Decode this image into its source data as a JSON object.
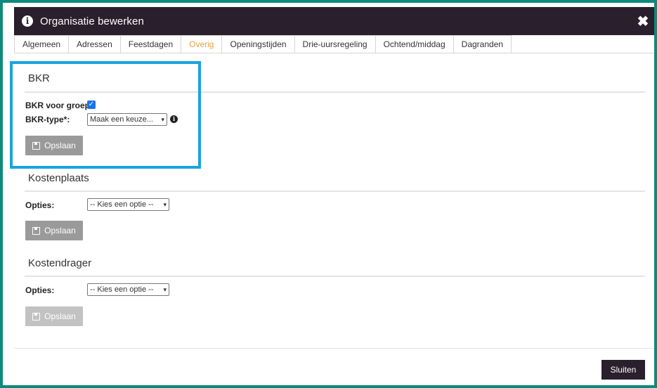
{
  "dialog": {
    "title": "Organisatie bewerken",
    "close_icon": "close-icon",
    "info_icon": "info-icon"
  },
  "tabs": [
    {
      "label": "Algemeen",
      "active": false
    },
    {
      "label": "Adressen",
      "active": false
    },
    {
      "label": "Feestdagen",
      "active": false
    },
    {
      "label": "Overig",
      "active": true
    },
    {
      "label": "Openingstijden",
      "active": false
    },
    {
      "label": "Drie-uursregeling",
      "active": false
    },
    {
      "label": "Ochtend/middag",
      "active": false
    },
    {
      "label": "Dagranden",
      "active": false
    }
  ],
  "bkr": {
    "title": "BKR",
    "group_label": "BKR voor groep:",
    "group_checked": true,
    "type_label": "BKR-type*:",
    "type_value": "Maak een keuze...",
    "save_label": "Opslaan"
  },
  "kostenplaats": {
    "title": "Kostenplaats",
    "options_label": "Opties:",
    "options_value": "-- Kies een optie --",
    "save_label": "Opslaan"
  },
  "kostendrager": {
    "title": "Kostendrager",
    "options_label": "Opties:",
    "options_value": "-- Kies een optie --",
    "save_label": "Opslaan"
  },
  "footer": {
    "close_label": "Sluiten"
  },
  "colors": {
    "frame": "#0d8a7a",
    "titlebar": "#2a1f2c",
    "active_tab": "#e8a040",
    "highlight": "#1aa3e0",
    "checkbox": "#1a73e8"
  }
}
